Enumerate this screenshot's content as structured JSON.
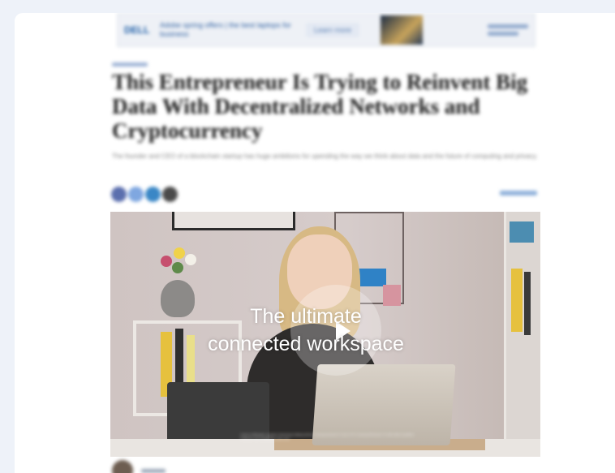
{
  "ad": {
    "logo": "DELL",
    "text": "Adobe spring offers | the best laptops for business",
    "cta": "Learn more",
    "side_lines": 2
  },
  "article": {
    "headline": "This Entrepreneur Is Trying to Reinvent Big Data With Decentralized Networks and Cryptocurrency",
    "deck": "The founder and CEO of a blockchain startup has huge ambitions for upending the way we think about data and the future of computing and privacy."
  },
  "share": {
    "icons": [
      "facebook-icon",
      "twitter-icon",
      "linkedin-icon",
      "email-icon"
    ],
    "colors": [
      "#5b6fae",
      "#7fa7e0",
      "#3a87c6",
      "#4a4a4a"
    ]
  },
  "video": {
    "overlay_line1": "The ultimate",
    "overlay_line2": "connected workspace",
    "disclaimer": "*Link to Windows requires Samsung Galaxy phone running Android 11 and a PC running Windows 10 with latest updates. Features and availability may vary."
  }
}
